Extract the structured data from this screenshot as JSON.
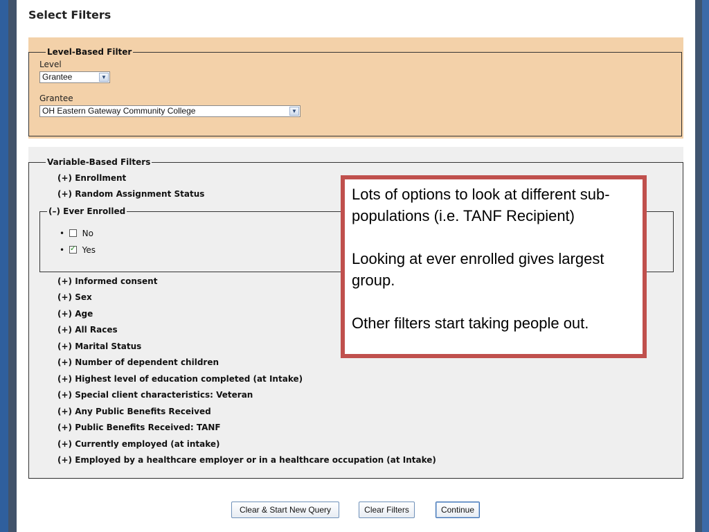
{
  "page": {
    "title": "Select Filters"
  },
  "level_filter": {
    "legend": "Level-Based Filter",
    "level_label": "Level",
    "level_value": "Grantee",
    "grantee_label": "Grantee",
    "grantee_value": "OH Eastern Gateway Community College",
    "arrow_icon": "▼"
  },
  "variable_filters": {
    "legend": "Variable-Based Filters",
    "items_top": [
      "(+) Enrollment",
      "(+) Random Assignment Status"
    ],
    "ever_enrolled": {
      "legend": "(–) Ever Enrolled",
      "options": [
        {
          "label": "No",
          "checked": false
        },
        {
          "label": "Yes",
          "checked": true
        }
      ],
      "bullet": "•",
      "check_glyph": "✓"
    },
    "items_bottom": [
      "(+) Informed consent",
      "(+) Sex",
      "(+) Age",
      "(+) All Races",
      "(+) Marital Status",
      "(+) Number of dependent children",
      "(+) Highest level of education completed (at Intake)",
      "(+) Special client characteristics: Veteran",
      "(+) Any Public Benefits Received",
      "(+) Public Benefits Received: TANF",
      "(+) Currently employed (at intake)",
      "(+) Employed by a healthcare employer or in a healthcare occupation (at Intake)"
    ]
  },
  "buttons": {
    "clear_start": "Clear & Start New Query",
    "clear_filters": "Clear Filters",
    "continue": "Continue"
  },
  "callout": {
    "para1": "Lots of options to look at different sub-populations (i.e. TANF Recipient)",
    "para2": "Looking at ever enrolled gives largest group.",
    "para3": "Other filters start taking people out.",
    "border_color": "#c0504d"
  },
  "colors": {
    "level_panel_bg": "#f3d1a9",
    "variable_panel_bg": "#efefef",
    "frame_blue": "#3c6aa8"
  }
}
